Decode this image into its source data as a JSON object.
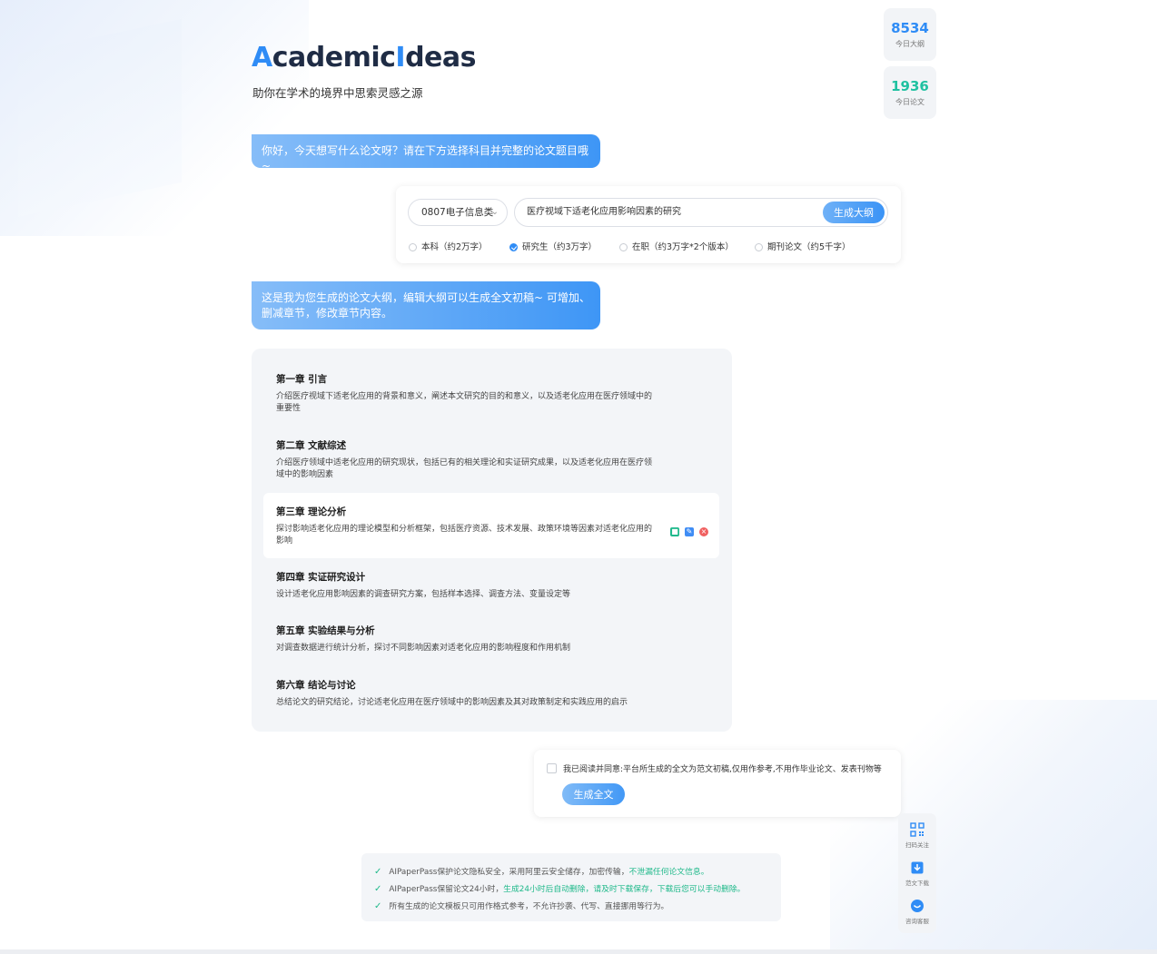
{
  "brand": {
    "logo_a": "A",
    "logo_mid": "cademic",
    "logo_i": "I",
    "logo_end": "deas",
    "tagline": "助你在学术的境界中思索灵感之源"
  },
  "stats": [
    {
      "value": "8534",
      "label": "今日大纲"
    },
    {
      "value": "1936",
      "label": "今日论文"
    }
  ],
  "chat": {
    "greeting": "你好，今天想写什么论文呀？请在下方选择科目并完整的论文题目哦~",
    "outline_intro": "这是我为您生成的论文大纲，编辑大纲可以生成全文初稿~ 可增加、删减章节，修改章节内容。"
  },
  "generator": {
    "subject": "0807电子信息类",
    "topic": "医疗视域下适老化应用影响因素的研究",
    "button": "生成大纲",
    "levels": [
      {
        "label": "本科（约2万字）",
        "selected": false
      },
      {
        "label": "研究生（约3万字）",
        "selected": true
      },
      {
        "label": "在职（约3万字*2个版本）",
        "selected": false
      },
      {
        "label": "期刊论文（约5千字）",
        "selected": false
      }
    ]
  },
  "outline": {
    "chapters": [
      {
        "title": "第一章 引言",
        "desc": "介绍医疗视域下适老化应用的背景和意义，阐述本文研究的目的和意义，以及适老化应用在医疗领域中的重要性"
      },
      {
        "title": "第二章 文献综述",
        "desc": "介绍医疗领域中适老化应用的研究现状，包括已有的相关理论和实证研究成果，以及适老化应用在医疗领域中的影响因素"
      },
      {
        "title": "第三章 理论分析",
        "desc": "探讨影响适老化应用的理论模型和分析框架，包括医疗资源、技术发展、政策环境等因素对适老化应用的影响"
      },
      {
        "title": "第四章 实证研究设计",
        "desc": "设计适老化应用影响因素的调查研究方案，包括样本选择、调查方法、变量设定等"
      },
      {
        "title": "第五章 实验结果与分析",
        "desc": "对调查数据进行统计分析，探讨不同影响因素对适老化应用的影响程度和作用机制"
      },
      {
        "title": "第六章 结论与讨论",
        "desc": "总结论文的研究结论，讨论适老化应用在医疗领域中的影响因素及其对政策制定和实践应用的启示"
      }
    ]
  },
  "fulltext": {
    "agreement": "我已阅读并同意:平台所生成的全文为范文初稿,仅用作参考,不用作毕业论文、发表刊物等",
    "button": "生成全文"
  },
  "side_tools": [
    {
      "label": "扫码关注",
      "icon": "qr-code-icon"
    },
    {
      "label": "范文下载",
      "icon": "download-icon"
    },
    {
      "label": "咨询客服",
      "icon": "chat-icon"
    }
  ],
  "notice": {
    "line1_pre": "AIPaperPass保护论文隐私安全，采用阿里云安全储存，加密传输，",
    "line1_hl": "不泄漏任何论文信息。",
    "line2_pre": "AIPaperPass保留论文24小时，",
    "line2_hl": "生成24小时后自动删除，请及时下载保存，下载后您可以手动删除。",
    "line3": "所有生成的论文模板只可用作格式参考，不允许抄袭、代写、直接挪用等行为。"
  },
  "colors": {
    "accent": "#2f8cf6",
    "green": "#1fb98a",
    "logo_dark": "#1f2c45"
  },
  "chart_data": {
    "type": "table",
    "categories": [
      "今日大纲",
      "今日论文"
    ],
    "values": [
      8534,
      1936
    ]
  }
}
